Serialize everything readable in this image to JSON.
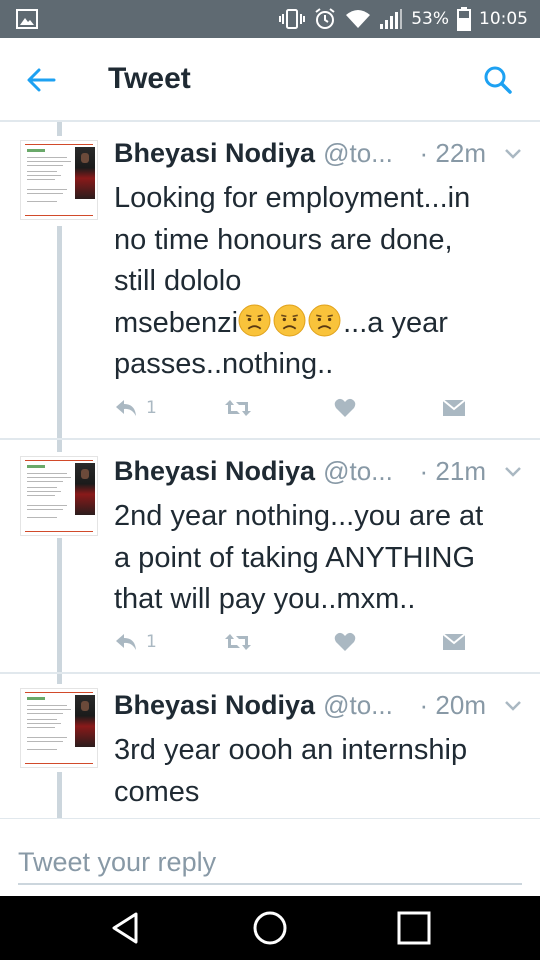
{
  "status_bar": {
    "battery_percent": "53%",
    "time": "10:05",
    "icons": [
      "gallery-icon",
      "vibrate-icon",
      "alarm-icon",
      "wifi-icon",
      "signal-icon",
      "battery-icon"
    ]
  },
  "header": {
    "title": "Tweet",
    "back_icon": "back-arrow-icon",
    "search_icon": "search-icon"
  },
  "tweets": [
    {
      "name": "Bheyasi Nodiya",
      "handle": "@to...",
      "time": "· 22m",
      "text_before": "Looking for employment...in\nno time honours are done,\nstill dololo\nmsebenzi",
      "emoji": [
        "disappointed-face-icon",
        "disappointed-face-icon",
        "disappointed-face-icon"
      ],
      "text_after": "...a year\npasses..nothing..",
      "reply_count": "1"
    },
    {
      "name": "Bheyasi Nodiya",
      "handle": "@to...",
      "time": "· 21m",
      "text": "2nd year nothing...you are at\na point of taking ANYTHING\nthat will pay you..mxm..",
      "reply_count": "1"
    },
    {
      "name": "Bheyasi Nodiya",
      "handle": "@to...",
      "time": "· 20m",
      "text": "3rd year oooh an internship\ncomes"
    }
  ],
  "reply_bar": {
    "placeholder": "Tweet your reply"
  },
  "colors": {
    "accent": "#1da1f2",
    "status_bar": "#5f6a72",
    "text": "#1f2a33",
    "muted": "#8899a6",
    "action_icons": "#aab8c2"
  }
}
